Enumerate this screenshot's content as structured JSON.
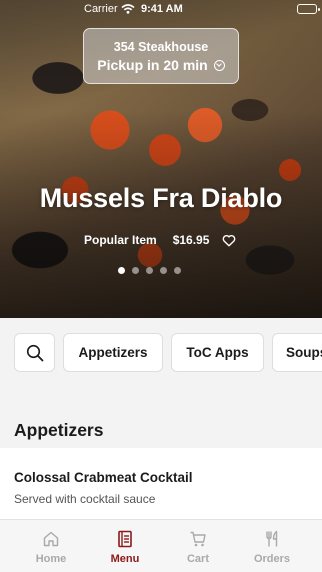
{
  "status_bar": {
    "carrier": "Carrier",
    "time": "9:41 AM"
  },
  "pickup": {
    "store_name": "354 Steakhouse",
    "pickup_time": "Pickup in 20 min"
  },
  "hero": {
    "title": "Mussels Fra Diablo",
    "tag": "Popular Item",
    "price": "$16.95",
    "carousel_pages": 5,
    "carousel_active": 0
  },
  "categories": [
    "Appetizers",
    "ToC Apps",
    "Soups"
  ],
  "section": {
    "title": "Appetizers",
    "items": [
      {
        "name": "Colossal Crabmeat Cocktail",
        "description": "Served with cocktail sauce"
      }
    ]
  },
  "tabs": [
    {
      "label": "Home",
      "icon": "home-icon",
      "active": false
    },
    {
      "label": "Menu",
      "icon": "menu-book-icon",
      "active": true
    },
    {
      "label": "Cart",
      "icon": "cart-icon",
      "active": false
    },
    {
      "label": "Orders",
      "icon": "utensils-icon",
      "active": false
    }
  ],
  "colors": {
    "accent": "#8c1a1a",
    "inactive_tab": "#a9a9a9",
    "background": "#f3f3f3"
  }
}
